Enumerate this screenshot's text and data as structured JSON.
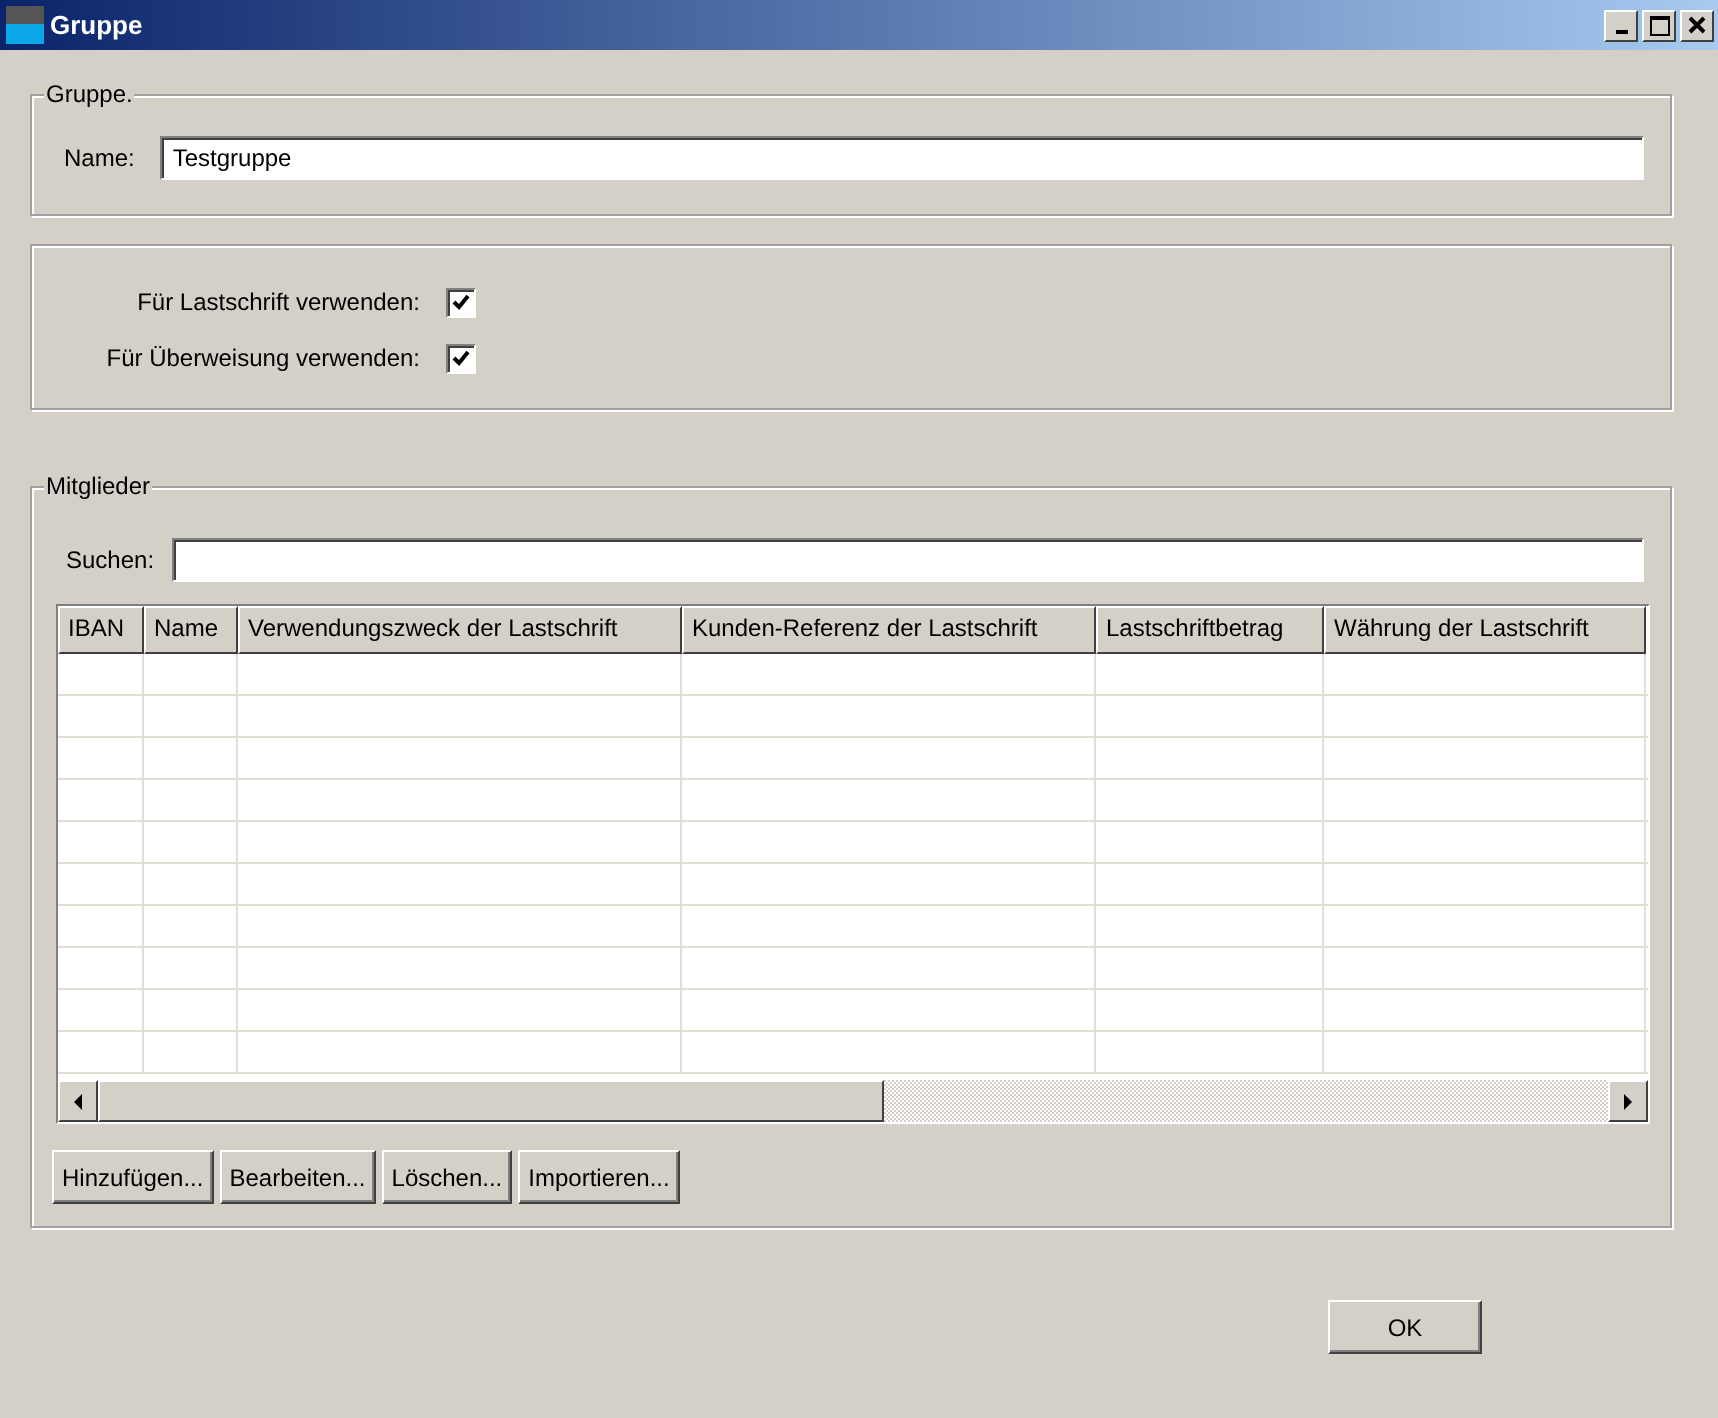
{
  "window": {
    "title": "Gruppe"
  },
  "group": {
    "legend": "Gruppe.",
    "name_label": "Name:",
    "name_value": "Testgruppe"
  },
  "options": [
    {
      "label": "Für Lastschrift verwenden:",
      "checked": true
    },
    {
      "label": "Für Überweisung verwenden:",
      "checked": true
    }
  ],
  "members": {
    "legend": "Mitglieder",
    "search_label": "Suchen:",
    "table": {
      "columns": [
        "IBAN",
        "Name",
        "Verwendungszweck der Lastschrift",
        "Kunden-Referenz der Lastschrift",
        "Lastschriftbetrag",
        "Währung der Lastschrift"
      ]
    },
    "buttons": [
      "Hinzufügen...",
      "Bearbeiten...",
      "Löschen...",
      "Importieren..."
    ]
  },
  "ok_button": "OK"
}
